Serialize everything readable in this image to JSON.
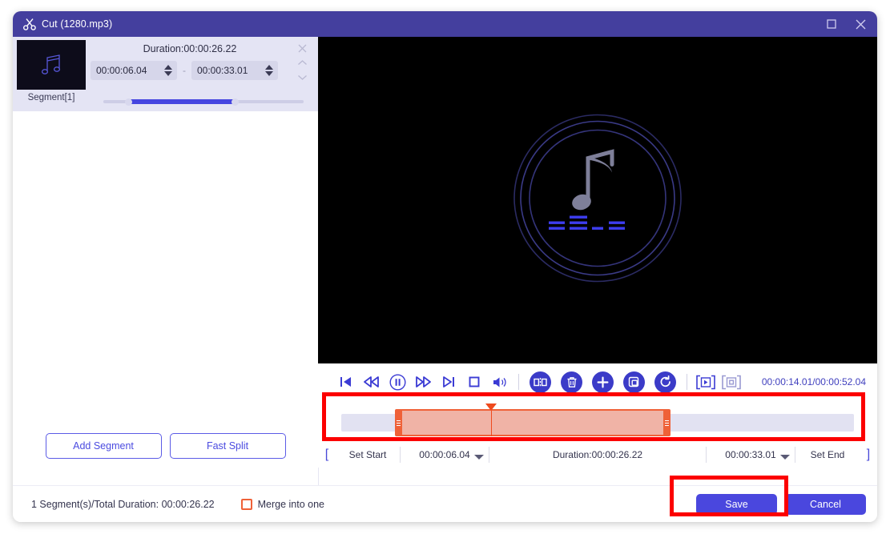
{
  "window": {
    "title": "Cut (1280.mp3)",
    "icon": "scissors-icon",
    "maximize_label": "Maximize",
    "close_label": "Close"
  },
  "segment_panel": {
    "thumbnail_icon": "music-note-icon",
    "segment_label": "Segment[1]",
    "duration_label": "Duration:00:00:26.22",
    "start_time": "00:00:06.04",
    "end_time": "00:00:33.01",
    "separator": "-",
    "close_icon": "close-icon",
    "up_icon": "chevron-up-icon",
    "down_icon": "chevron-down-icon",
    "add_segment_label": "Add Segment",
    "fast_split_label": "Fast Split"
  },
  "preview": {
    "artwork": "music-note-album-art",
    "background_color": "#000000"
  },
  "controls": {
    "buttons": [
      {
        "name": "previous-frame-icon",
        "label": "Previous"
      },
      {
        "name": "rewind-icon",
        "label": "Rewind"
      },
      {
        "name": "pause-icon",
        "label": "Pause"
      },
      {
        "name": "fast-forward-icon",
        "label": "Fast Forward"
      },
      {
        "name": "next-frame-icon",
        "label": "Next"
      },
      {
        "name": "stop-icon",
        "label": "Stop"
      },
      {
        "name": "volume-icon",
        "label": "Volume"
      }
    ],
    "round_buttons": [
      {
        "name": "split-icon",
        "label": "Split"
      },
      {
        "name": "delete-icon",
        "label": "Delete"
      },
      {
        "name": "add-icon",
        "label": "Add"
      },
      {
        "name": "copy-icon",
        "label": "Copy"
      },
      {
        "name": "reset-icon",
        "label": "Reset"
      }
    ],
    "bracket_buttons": [
      {
        "name": "play-segment-icon",
        "label": "Play Segment"
      },
      {
        "name": "stop-segment-icon",
        "label": "Stop Segment"
      }
    ],
    "timecode": "00:00:14.01/00:00:52.04"
  },
  "timeline": {
    "selection_color": "#ef6138",
    "playhead_position": "00:00:14.01"
  },
  "set_row": {
    "start_bracket": "[",
    "set_start_label": "Set Start",
    "start_value": "00:00:06.04",
    "duration_label": "Duration:00:00:26.22",
    "end_value": "00:00:33.01",
    "set_end_label": "Set End",
    "end_bracket": "]"
  },
  "footer": {
    "status": "1 Segment(s)/Total Duration: 00:00:26.22",
    "merge_label": "Merge into one",
    "merge_checked": false,
    "save_label": "Save",
    "cancel_label": "Cancel"
  },
  "colors": {
    "accent": "#4a47de",
    "titlebar": "#443f9e",
    "highlight": "#ef6138",
    "annotation": "#fc0000"
  }
}
